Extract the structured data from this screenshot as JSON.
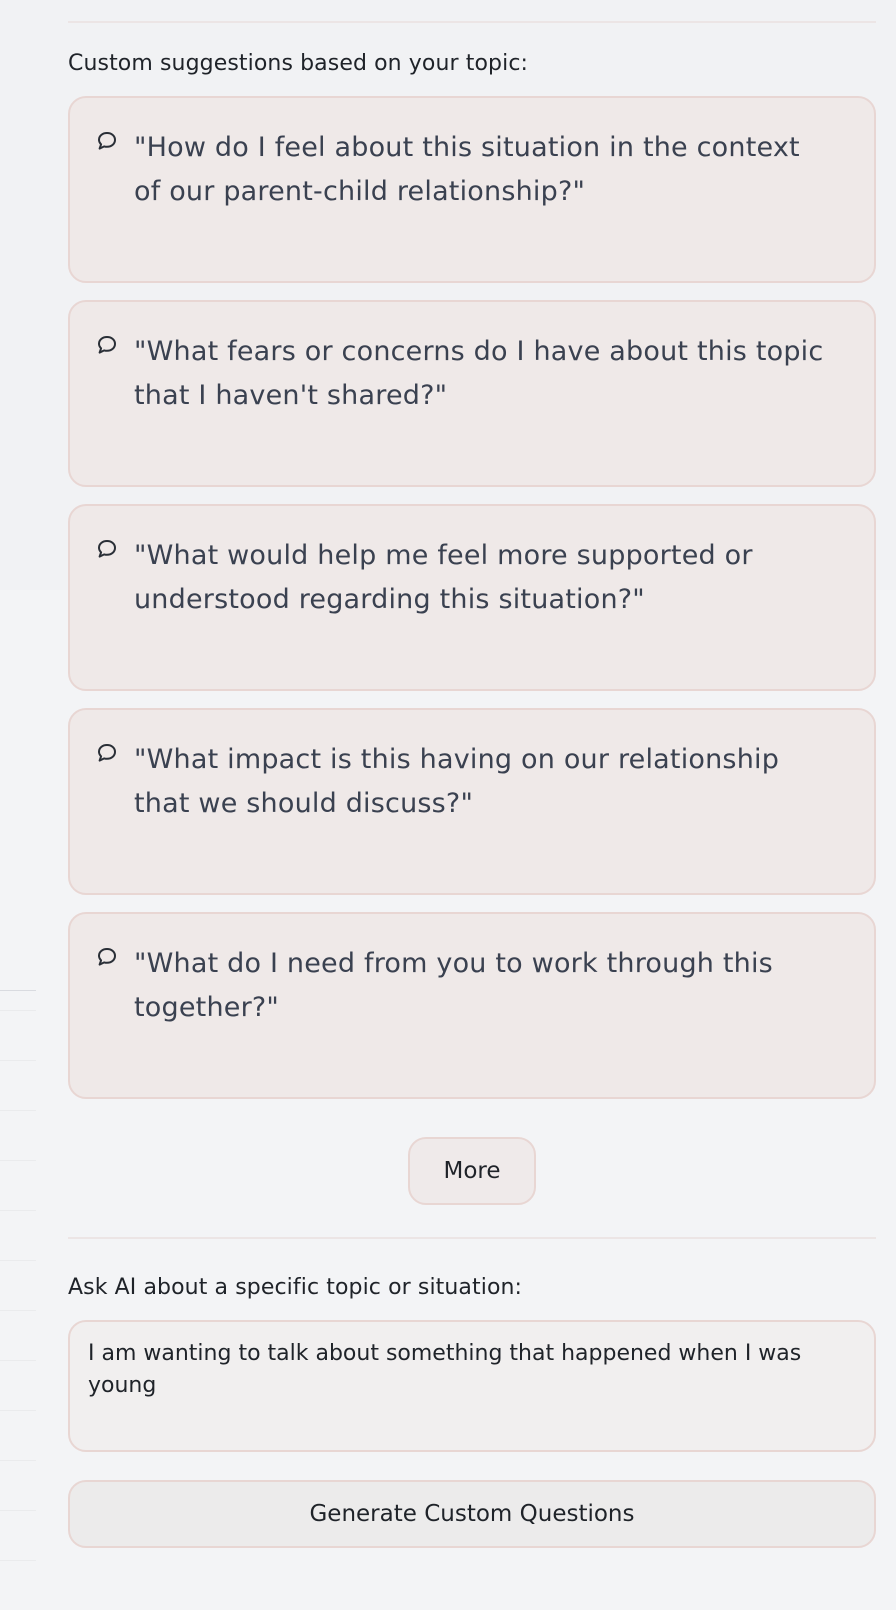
{
  "suggestions_section": {
    "label": "Custom suggestions based on your topic:",
    "items": [
      {
        "icon": "speech-bubble-icon",
        "text": "\"How do I feel about this situation in the context of our parent-child relationship?\""
      },
      {
        "icon": "speech-bubble-icon",
        "text": "\"What fears or concerns do I have about this topic that I haven't shared?\""
      },
      {
        "icon": "speech-bubble-icon",
        "text": "\"What would help me feel more supported or understood regarding this situation?\""
      },
      {
        "icon": "speech-bubble-icon",
        "text": "\"What impact is this having on our relationship that we should discuss?\""
      },
      {
        "icon": "speech-bubble-icon",
        "text": "\"What do I need from you to work through this together?\""
      }
    ],
    "more_label": "More"
  },
  "ask_ai_section": {
    "label": "Ask AI about a specific topic or situation:",
    "topic_value": "I am wanting to talk about something that happened when I was young",
    "generate_label": "Generate Custom Questions"
  },
  "colors": {
    "page_background": "#f3f4f6",
    "card_background": "#efe9e8",
    "card_border": "#e8d6d3",
    "text_primary": "#1f2329",
    "text_question": "#3a4150"
  }
}
